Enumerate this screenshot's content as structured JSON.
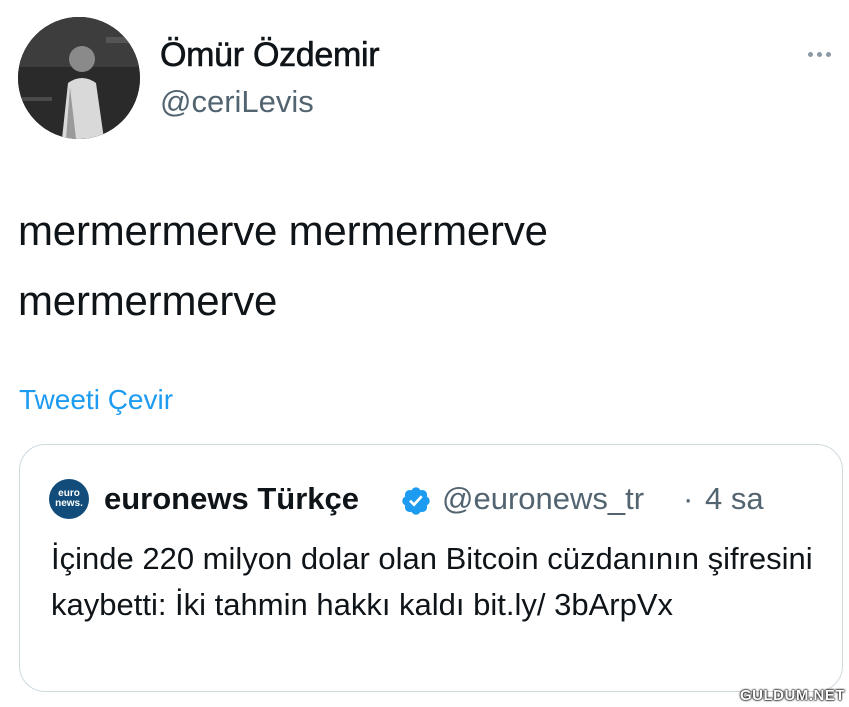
{
  "tweet": {
    "author_name": "Ömür Özdemir",
    "author_handle": "@ceriLevis",
    "text": "mermermerve mermermerve mermermerve",
    "translate_link": "Tweeti Çevir",
    "more_icon": "more-horizontal-icon"
  },
  "quoted_tweet": {
    "logo_text_top": "euro",
    "logo_text_bottom": "news.",
    "author_name": "euronews Türkçe",
    "verified_icon": "verified-badge-icon",
    "author_handle": "@euronews_tr",
    "separator": "·",
    "time": "4 sa",
    "text": "İçinde 220 milyon dolar olan Bitcoin cüzdanının şifresini kaybetti: İki tahmin hakkı kaldı  bit.ly/ 3bArpVx"
  },
  "watermark": "GULDUM.NET",
  "colors": {
    "link": "#1d9bf0",
    "secondary_text": "#536471",
    "border": "#cfd9de",
    "verified": "#1d9bf0"
  }
}
